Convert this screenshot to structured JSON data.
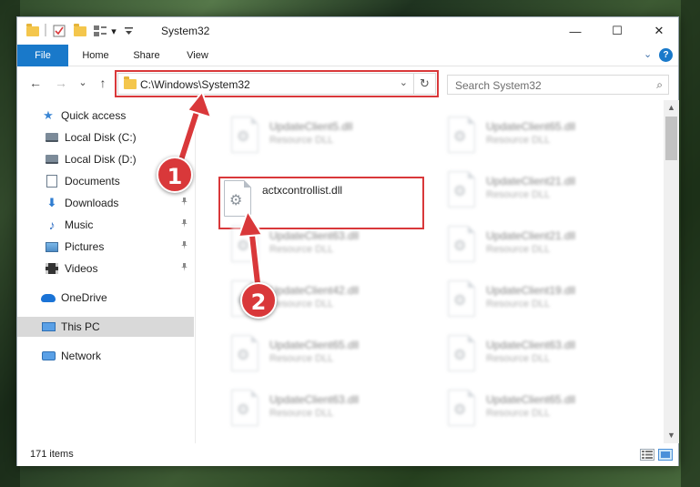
{
  "window": {
    "title": "System32",
    "controls": {
      "minimize": "—",
      "maximize": "☐",
      "close": "✕"
    }
  },
  "quick_access_toolbar": {
    "dropdown": "▾"
  },
  "ribbon": {
    "tabs": [
      "File",
      "Home",
      "Share",
      "View"
    ],
    "expand": "⌄",
    "help": "?"
  },
  "navigation": {
    "back": "←",
    "forward": "→",
    "recent": "⌄",
    "up": "↑",
    "address": "C:\\Windows\\System32",
    "address_dropdown": "⌄",
    "refresh": "↻",
    "search_placeholder": "Search System32",
    "search_icon": "⌕"
  },
  "nav_pane": {
    "items": [
      {
        "label": "Quick access",
        "icon": "star-icon"
      },
      {
        "label": "Local Disk (C:)",
        "icon": "drive-icon"
      },
      {
        "label": "Local Disk (D:)",
        "icon": "drive-icon"
      },
      {
        "label": "Documents",
        "icon": "documents-icon"
      },
      {
        "label": "Downloads",
        "icon": "downloads-icon",
        "pinned": true
      },
      {
        "label": "Music",
        "icon": "music-icon",
        "pinned": true
      },
      {
        "label": "Pictures",
        "icon": "pictures-icon",
        "pinned": true
      },
      {
        "label": "Videos",
        "icon": "videos-icon",
        "pinned": true
      },
      {
        "label": "OneDrive",
        "icon": "onedrive-icon"
      },
      {
        "label": "This PC",
        "icon": "this-pc-icon",
        "selected": true
      },
      {
        "label": "Network",
        "icon": "network-icon"
      }
    ],
    "pin_glyph": "📌"
  },
  "files": {
    "focused": {
      "name": "actxcontrollist.dll",
      "type": ""
    },
    "blurred_left": [
      {
        "name": "UpdateClient5.dll",
        "type": "Resource DLL"
      },
      {
        "name": "UpdateClient63.dll",
        "type": "Resource DLL"
      },
      {
        "name": "UpdateClient42.dll",
        "type": "Resource DLL"
      },
      {
        "name": "UpdateClient65.dll",
        "type": "Resource DLL"
      },
      {
        "name": "UpdateClient63.dll",
        "type": "Resource DLL"
      }
    ],
    "blurred_right": [
      {
        "name": "UpdateClient65.dll",
        "type": "Resource DLL"
      },
      {
        "name": "UpdateClient21.dll",
        "type": "Resource DLL"
      },
      {
        "name": "UpdateClient21.dll",
        "type": "Resource DLL"
      },
      {
        "name": "UpdateClient19.dll",
        "type": "Resource DLL"
      },
      {
        "name": "UpdateClient63.dll",
        "type": "Resource DLL"
      },
      {
        "name": "UpdateClient65.dll",
        "type": "Resource DLL"
      }
    ]
  },
  "scrollbar": {
    "up": "▲",
    "down": "▼"
  },
  "status": {
    "item_count": "171 items"
  },
  "annotations": {
    "step1": "1",
    "step2": "2"
  },
  "colors": {
    "accent": "#1979ca",
    "highlight": "#d9383a",
    "selected_nav": "#d9d9d9"
  }
}
